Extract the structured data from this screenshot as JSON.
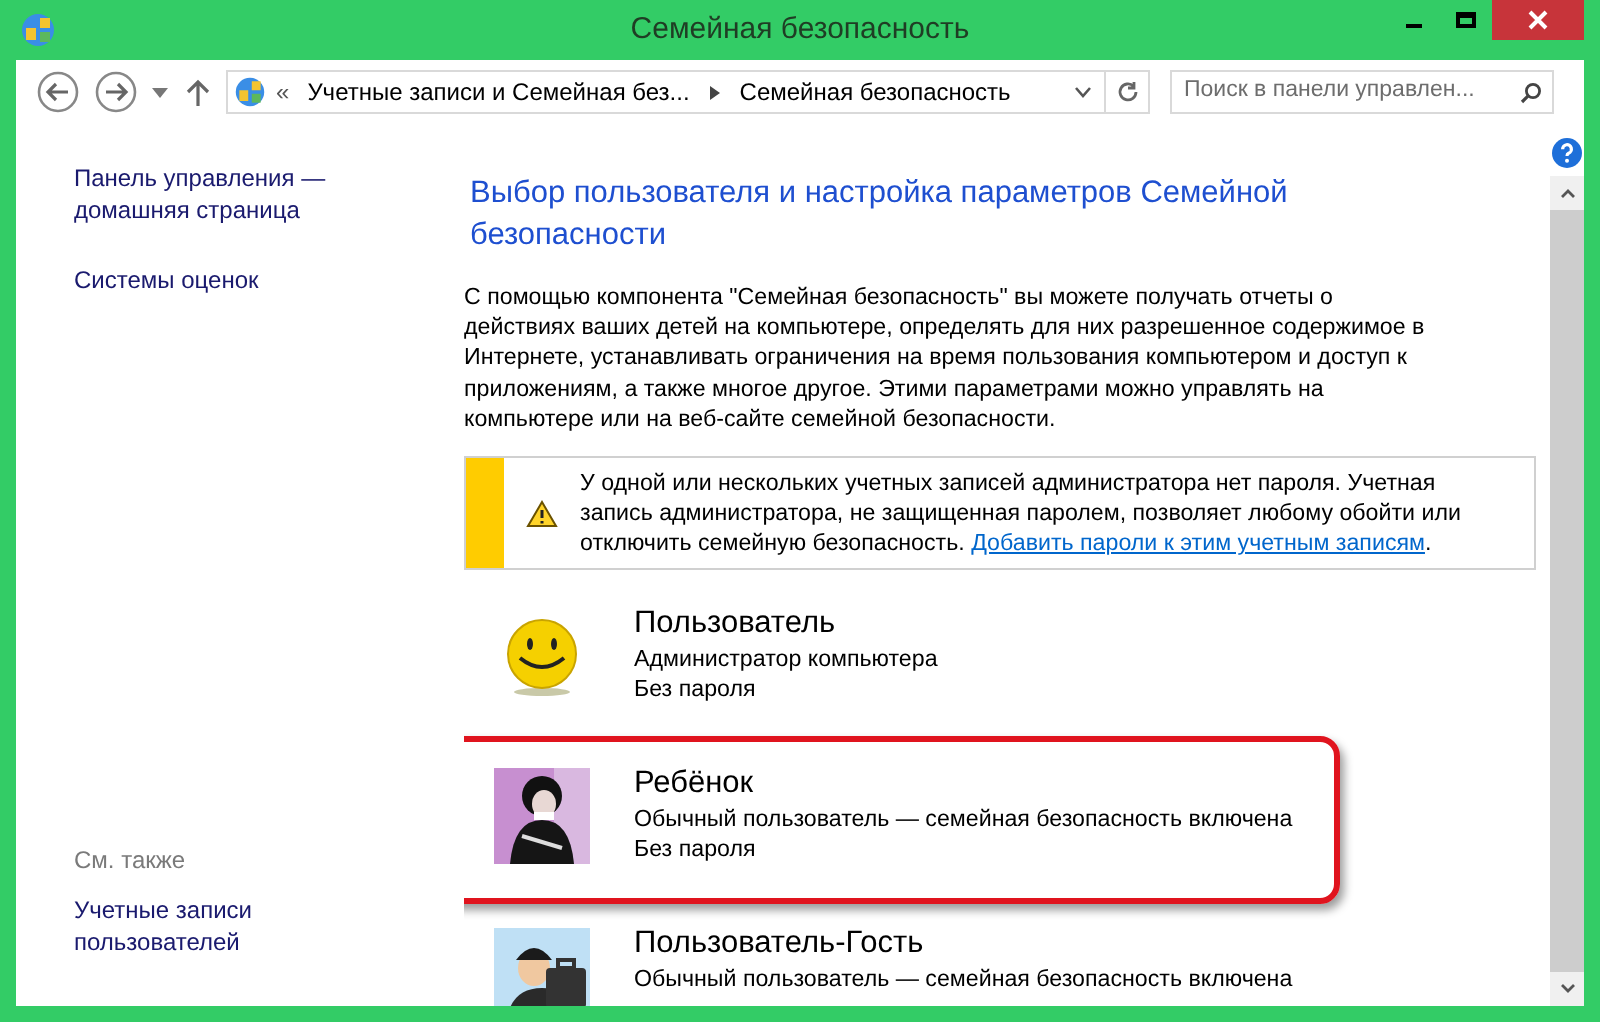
{
  "window": {
    "title": "Семейная безопасность"
  },
  "address_bar": {
    "overflow": "«",
    "crumbs": [
      {
        "label": "Учетные записи и Семейная без..."
      },
      {
        "label": "Семейная безопасность"
      }
    ]
  },
  "search": {
    "placeholder": "Поиск в панели управлен..."
  },
  "sidebar": {
    "items": [
      {
        "label": "Панель управления — домашняя страница"
      },
      {
        "label": "Системы оценок"
      }
    ],
    "see_also": {
      "heading": "См. также",
      "items": [
        {
          "label": "Учетные записи пользователей"
        }
      ]
    }
  },
  "heading": "Выбор пользователя и настройка параметров Семейной безопасности",
  "intro": "С помощью компонента \"Семейная безопасность\" вы можете получать отчеты о действиях ваших детей на компьютере, определять для них разрешенное содержимое в Интернете, устанавливать ограничения на время пользования компьютером и доступ к приложениям, а также многое другое. Этими параметрами можно управлять на компьютере или на веб-сайте семейной безопасности.",
  "warning": {
    "text": "У одной или нескольких учетных записей администратора нет пароля. Учетная запись администратора, не защищенная паролем, позволяет любому обойти или отключить семейную безопасность.",
    "link": "Добавить пароли к этим учетным записям",
    "suffix": "."
  },
  "users": [
    {
      "name": "Пользователь",
      "role": "Администратор компьютера",
      "password": "Без пароля",
      "kind": "smiley",
      "selected": false
    },
    {
      "name": "Ребёнок",
      "role": "Обычный пользователь — семейная безопасность включена",
      "password": "Без пароля",
      "kind": "child",
      "selected": true
    },
    {
      "name": "Пользователь-Гость",
      "role": "Обычный пользователь — семейная безопасность включена",
      "kind": "guest",
      "selected": false
    }
  ]
}
